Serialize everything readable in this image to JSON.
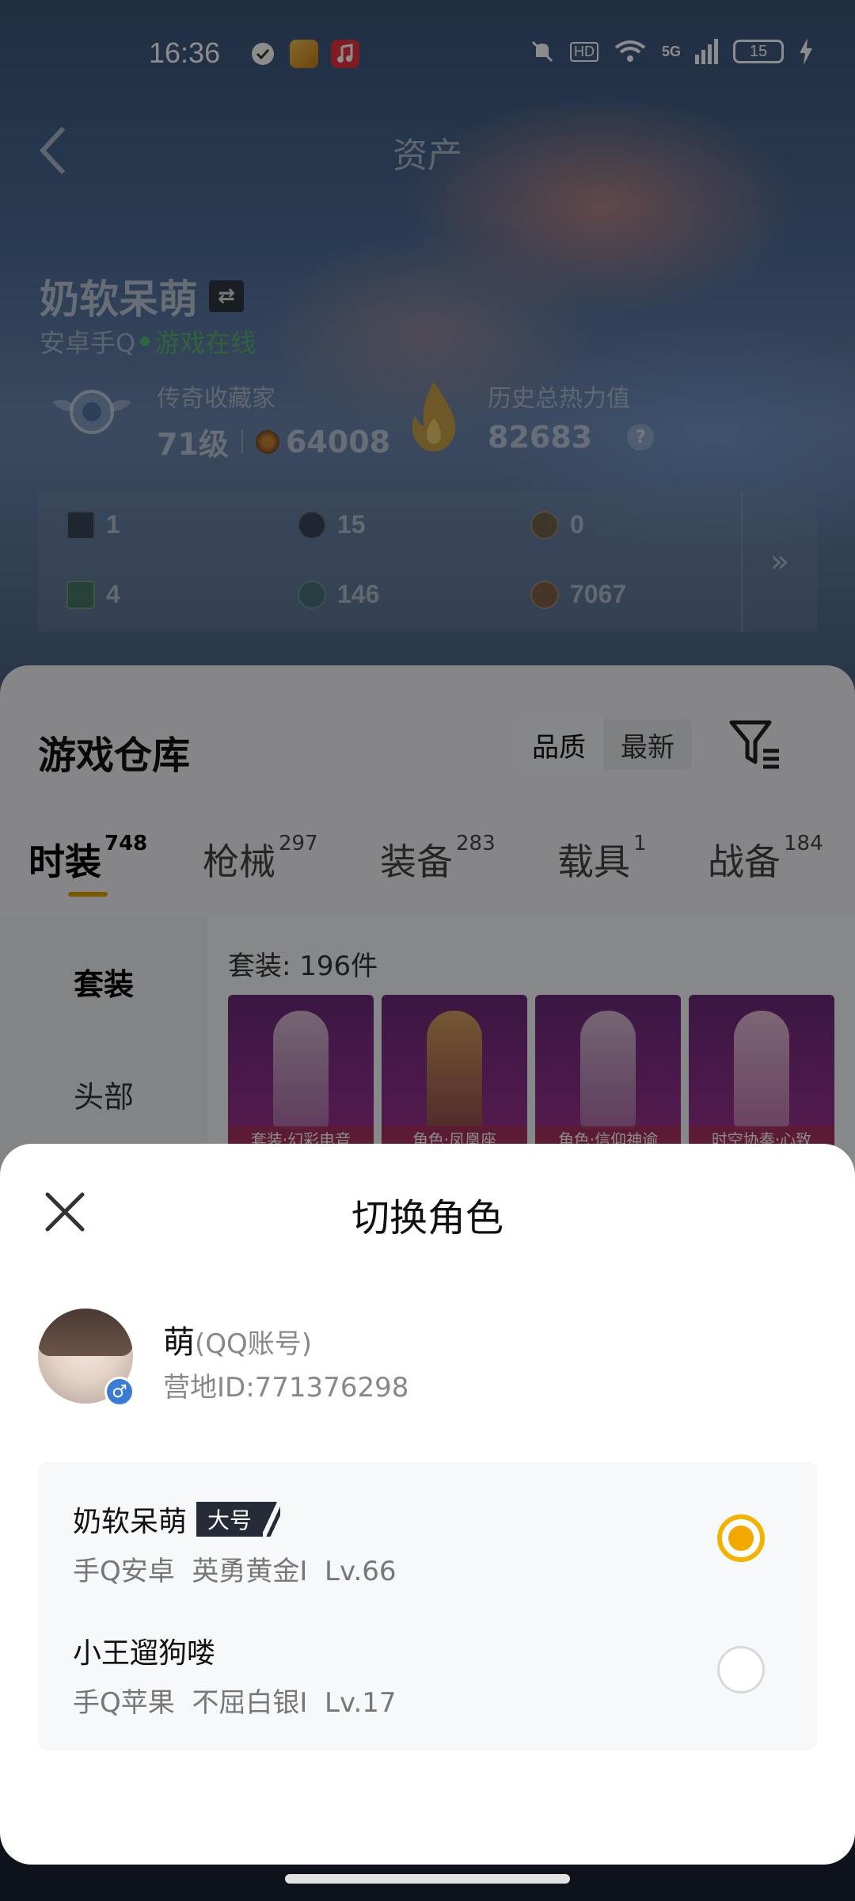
{
  "status_bar": {
    "time": "16:36",
    "network": "5G",
    "hd": "HD",
    "battery": "15",
    "app_icons": [
      "shield-app-icon",
      "game-app-icon",
      "music-app-icon"
    ]
  },
  "header": {
    "title": "资产",
    "back_icon": "chevron-left-icon"
  },
  "profile": {
    "name": "奶软呆萌",
    "platform": "安卓手Q",
    "online_status": "游戏在线",
    "collector_label": "传奇收藏家",
    "collector_level": "71级",
    "coins": "64008",
    "heat_label": "历史总热力值",
    "heat_value": "82683",
    "help_mark": "?"
  },
  "assets": {
    "row1": [
      "1",
      "15",
      "0"
    ],
    "row2": [
      "4",
      "146",
      "7067"
    ],
    "more": "»"
  },
  "warehouse": {
    "title": "游戏仓库",
    "sort_options": [
      "品质",
      "最新"
    ],
    "tabs": [
      {
        "label": "时装",
        "count": "748"
      },
      {
        "label": "枪械",
        "count": "297"
      },
      {
        "label": "装备",
        "count": "283"
      },
      {
        "label": "载具",
        "count": "1"
      },
      {
        "label": "战备",
        "count": "184"
      }
    ],
    "side_nav": [
      "套装",
      "头部"
    ],
    "set_count": "套装: 196件",
    "cards": [
      "套装·幻彩电音",
      "角色·凤凰座",
      "角色·信仰神谕",
      "时空协奏·心致"
    ]
  },
  "sheet": {
    "title": "切换角色",
    "account": {
      "name": "萌",
      "type": "(QQ账号)",
      "camp_id": "营地ID:771376298",
      "gender": "♂"
    },
    "roles": [
      {
        "name": "奶软呆萌",
        "badge": "大号",
        "platform": "手Q安卓",
        "rank": "英勇黄金I",
        "level": "Lv.66",
        "selected": true
      },
      {
        "name": "小王遛狗喽",
        "badge": "",
        "platform": "手Q苹果",
        "rank": "不屈白银I",
        "level": "Lv.17",
        "selected": false
      }
    ]
  },
  "colors": {
    "accent": "#f3b300",
    "online": "#4cd964",
    "badge_bg": "#262b38"
  }
}
